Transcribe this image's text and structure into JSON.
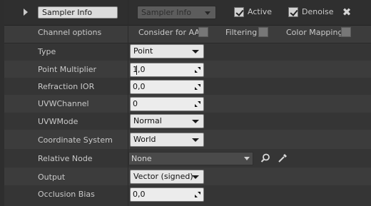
{
  "header": {
    "name_value": "Sampler Info",
    "sampler_type": "Sampler Info",
    "active_label": "Active",
    "active_checked": true,
    "denoise_label": "Denoise",
    "denoise_checked": true
  },
  "channel_options": {
    "label": "Channel options",
    "consider_aa_label": "Consider for AA",
    "consider_aa_checked": false,
    "filtering_label": "Filtering",
    "filtering_checked": false,
    "color_mapping_label": "Color Mapping",
    "color_mapping_checked": false
  },
  "properties": {
    "type": {
      "label": "Type",
      "value": "Point"
    },
    "point_multiplier": {
      "label": "Point Multiplier",
      "value": "1,0"
    },
    "refraction_ior": {
      "label": "Refraction IOR",
      "value": "0,0"
    },
    "uvw_channel": {
      "label": "UVWChannel",
      "value": "0"
    },
    "uvw_mode": {
      "label": "UVWMode",
      "value": "Normal"
    },
    "coordinate_system": {
      "label": "Coordinate System",
      "value": "World"
    },
    "relative_node": {
      "label": "Relative Node",
      "value": "None"
    },
    "output": {
      "label": "Output",
      "value": "Vector (signed)"
    },
    "occlusion_bias": {
      "label": "Occlusion Bias",
      "value": "0,0"
    }
  },
  "icons": {
    "expand": "triangle-right-icon",
    "remove": "close-icon",
    "browse": "magnifier-icon",
    "pick": "eyedropper-icon"
  }
}
